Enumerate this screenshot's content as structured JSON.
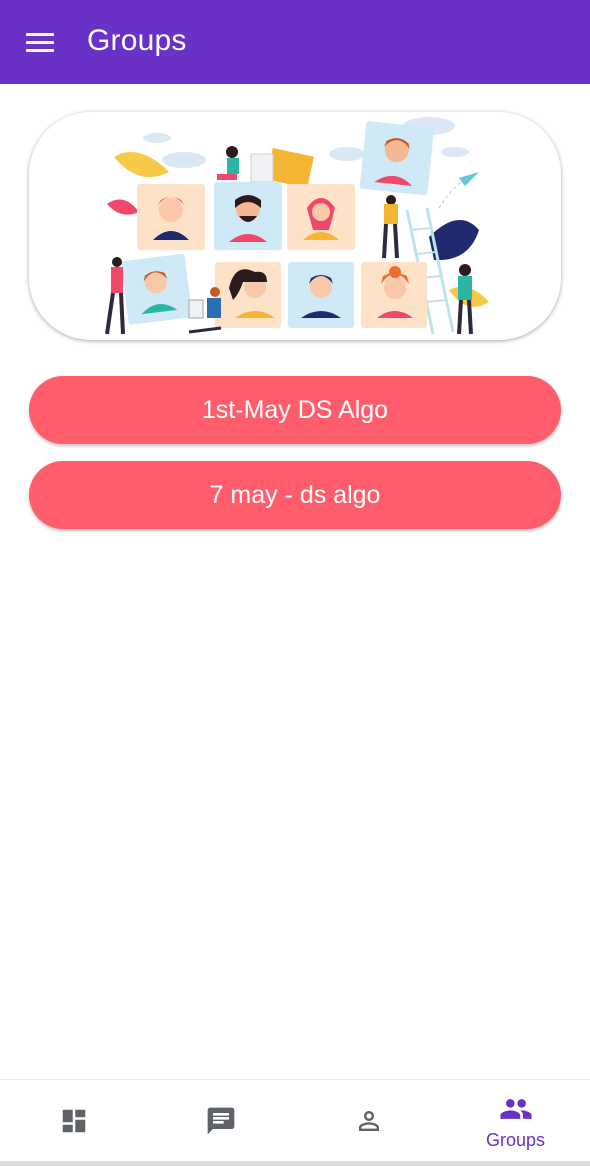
{
  "app_bar": {
    "title": "Groups"
  },
  "groups": [
    {
      "label": "1st-May DS Algo"
    },
    {
      "label": "7 may - ds algo"
    }
  ],
  "bottom_nav": {
    "items": [
      {
        "icon": "dashboard-icon",
        "label": ""
      },
      {
        "icon": "chat-icon",
        "label": ""
      },
      {
        "icon": "person-icon",
        "label": ""
      },
      {
        "icon": "groups-icon",
        "label": "Groups",
        "active": true
      }
    ]
  },
  "colors": {
    "primary": "#6a31c6",
    "accent": "#ff5c6c",
    "nav_icon": "#5f6368"
  }
}
